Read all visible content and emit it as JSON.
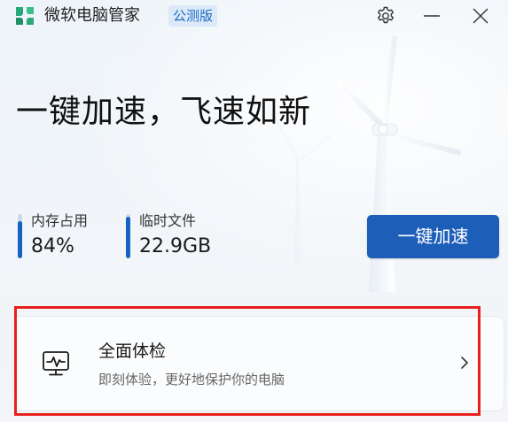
{
  "titlebar": {
    "app_title": "微软电脑管家",
    "edition_badge": "公测版",
    "logo_icon": "app-logo-icon",
    "settings_icon": "gear-icon",
    "minimize_icon": "minimize-icon",
    "close_icon": "close-icon"
  },
  "hero": {
    "headline": "一键加速，飞速如新",
    "background_icon": "wind-turbine-illustration"
  },
  "stats": {
    "memory": {
      "label": "内存占用",
      "value": "84%",
      "level": 0.84
    },
    "temp_files": {
      "label": "临时文件",
      "value": "22.9GB",
      "level": 0.95
    }
  },
  "boost_button": {
    "label": "一键加速"
  },
  "scan_card": {
    "title": "全面体检",
    "description": "即刻体验，更好地保护你的电脑",
    "icon": "pc-health-monitor-icon",
    "chevron_icon": "chevron-right-icon"
  },
  "colors": {
    "accent": "#1d5fb8",
    "bar_fill": "#1462c2",
    "badge_bg": "#dbe9f8",
    "badge_text": "#1d6ac5",
    "highlight": "#e8201c",
    "logo_green": "#2aa87a"
  }
}
